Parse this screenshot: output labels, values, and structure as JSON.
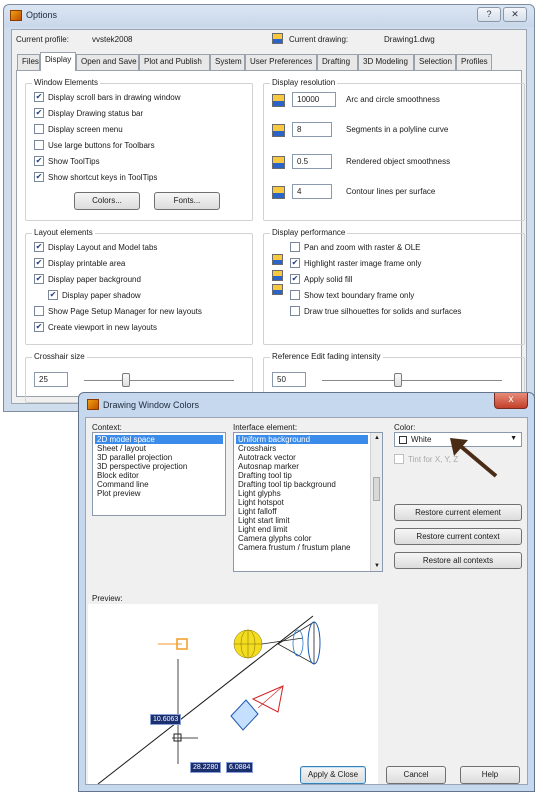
{
  "options": {
    "title": "Options",
    "help_glyph": "?",
    "close_glyph": "✕",
    "current_profile_label": "Current profile:",
    "current_profile_value": "vvstek2008",
    "current_drawing_label": "Current drawing:",
    "current_drawing_value": "Drawing1.dwg",
    "tabs": [
      "Files",
      "Display",
      "Open and Save",
      "Plot and Publish",
      "System",
      "User Preferences",
      "Drafting",
      "3D Modeling",
      "Selection",
      "Profiles"
    ],
    "active_tab": "Display",
    "window_elements": {
      "title": "Window Elements",
      "items": [
        {
          "label": "Display scroll bars in drawing window",
          "checked": true
        },
        {
          "label": "Display Drawing status bar",
          "checked": true
        },
        {
          "label": "Display screen menu",
          "checked": false
        },
        {
          "label": "Use large buttons for Toolbars",
          "checked": false
        },
        {
          "label": "Show ToolTips",
          "checked": true
        },
        {
          "label": "Show shortcut keys in ToolTips",
          "checked": true
        }
      ],
      "colors_button": "Colors...",
      "fonts_button": "Fonts..."
    },
    "display_resolution": {
      "title": "Display resolution",
      "items": [
        {
          "value": "10000",
          "label": "Arc and circle smoothness"
        },
        {
          "value": "8",
          "label": "Segments in a polyline curve"
        },
        {
          "value": "0.5",
          "label": "Rendered object smoothness"
        },
        {
          "value": "4",
          "label": "Contour lines per surface"
        }
      ]
    },
    "layout_elements": {
      "title": "Layout elements",
      "items": [
        {
          "label": "Display Layout and Model tabs",
          "checked": true
        },
        {
          "label": "Display printable area",
          "checked": true
        },
        {
          "label": "Display paper background",
          "checked": true
        },
        {
          "label": "Display paper shadow",
          "checked": true
        },
        {
          "label": "Show Page Setup Manager for new layouts",
          "checked": false
        },
        {
          "label": "Create viewport in new layouts",
          "checked": true
        }
      ]
    },
    "display_performance": {
      "title": "Display performance",
      "items": [
        {
          "label": "Pan and zoom with raster & OLE",
          "checked": false
        },
        {
          "label": "Highlight raster image frame only",
          "checked": true
        },
        {
          "label": "Apply solid fill",
          "checked": true
        },
        {
          "label": "Show text boundary frame only",
          "checked": false
        },
        {
          "label": "Draw true silhouettes for solids and surfaces",
          "checked": false
        }
      ]
    },
    "crosshair": {
      "label": "Crosshair size",
      "value": "25"
    },
    "xref_fading": {
      "label": "Reference Edit fading intensity",
      "value": "50"
    }
  },
  "dwc": {
    "title": "Drawing Window Colors",
    "close_glyph": "x",
    "context_label": "Context:",
    "context_items": [
      "2D model space",
      "Sheet / layout",
      "3D parallel projection",
      "3D perspective projection",
      "Block editor",
      "Command line",
      "Plot preview"
    ],
    "context_selected": 0,
    "interface_label": "Interface element:",
    "interface_items": [
      "Uniform background",
      "Crosshairs",
      "Autotrack vector",
      "Autosnap marker",
      "Drafting tool tip",
      "Drafting tool tip background",
      "Light glyphs",
      "Light hotspot",
      "Light falloff",
      "Light start limit",
      "Light end limit",
      "Camera glyphs color",
      "Camera frustum / frustum plane"
    ],
    "interface_selected": 0,
    "color_label": "Color:",
    "color_value": "White",
    "tint_label": "Tint for X, Y, Z",
    "restore_element": "Restore current element",
    "restore_context": "Restore current context",
    "restore_all": "Restore all contexts",
    "preview_label": "Preview:",
    "coord_a": "10.6063",
    "coord_b": "28.2280",
    "coord_c": "6.0884",
    "apply_close": "Apply & Close",
    "cancel": "Cancel",
    "help": "Help"
  }
}
